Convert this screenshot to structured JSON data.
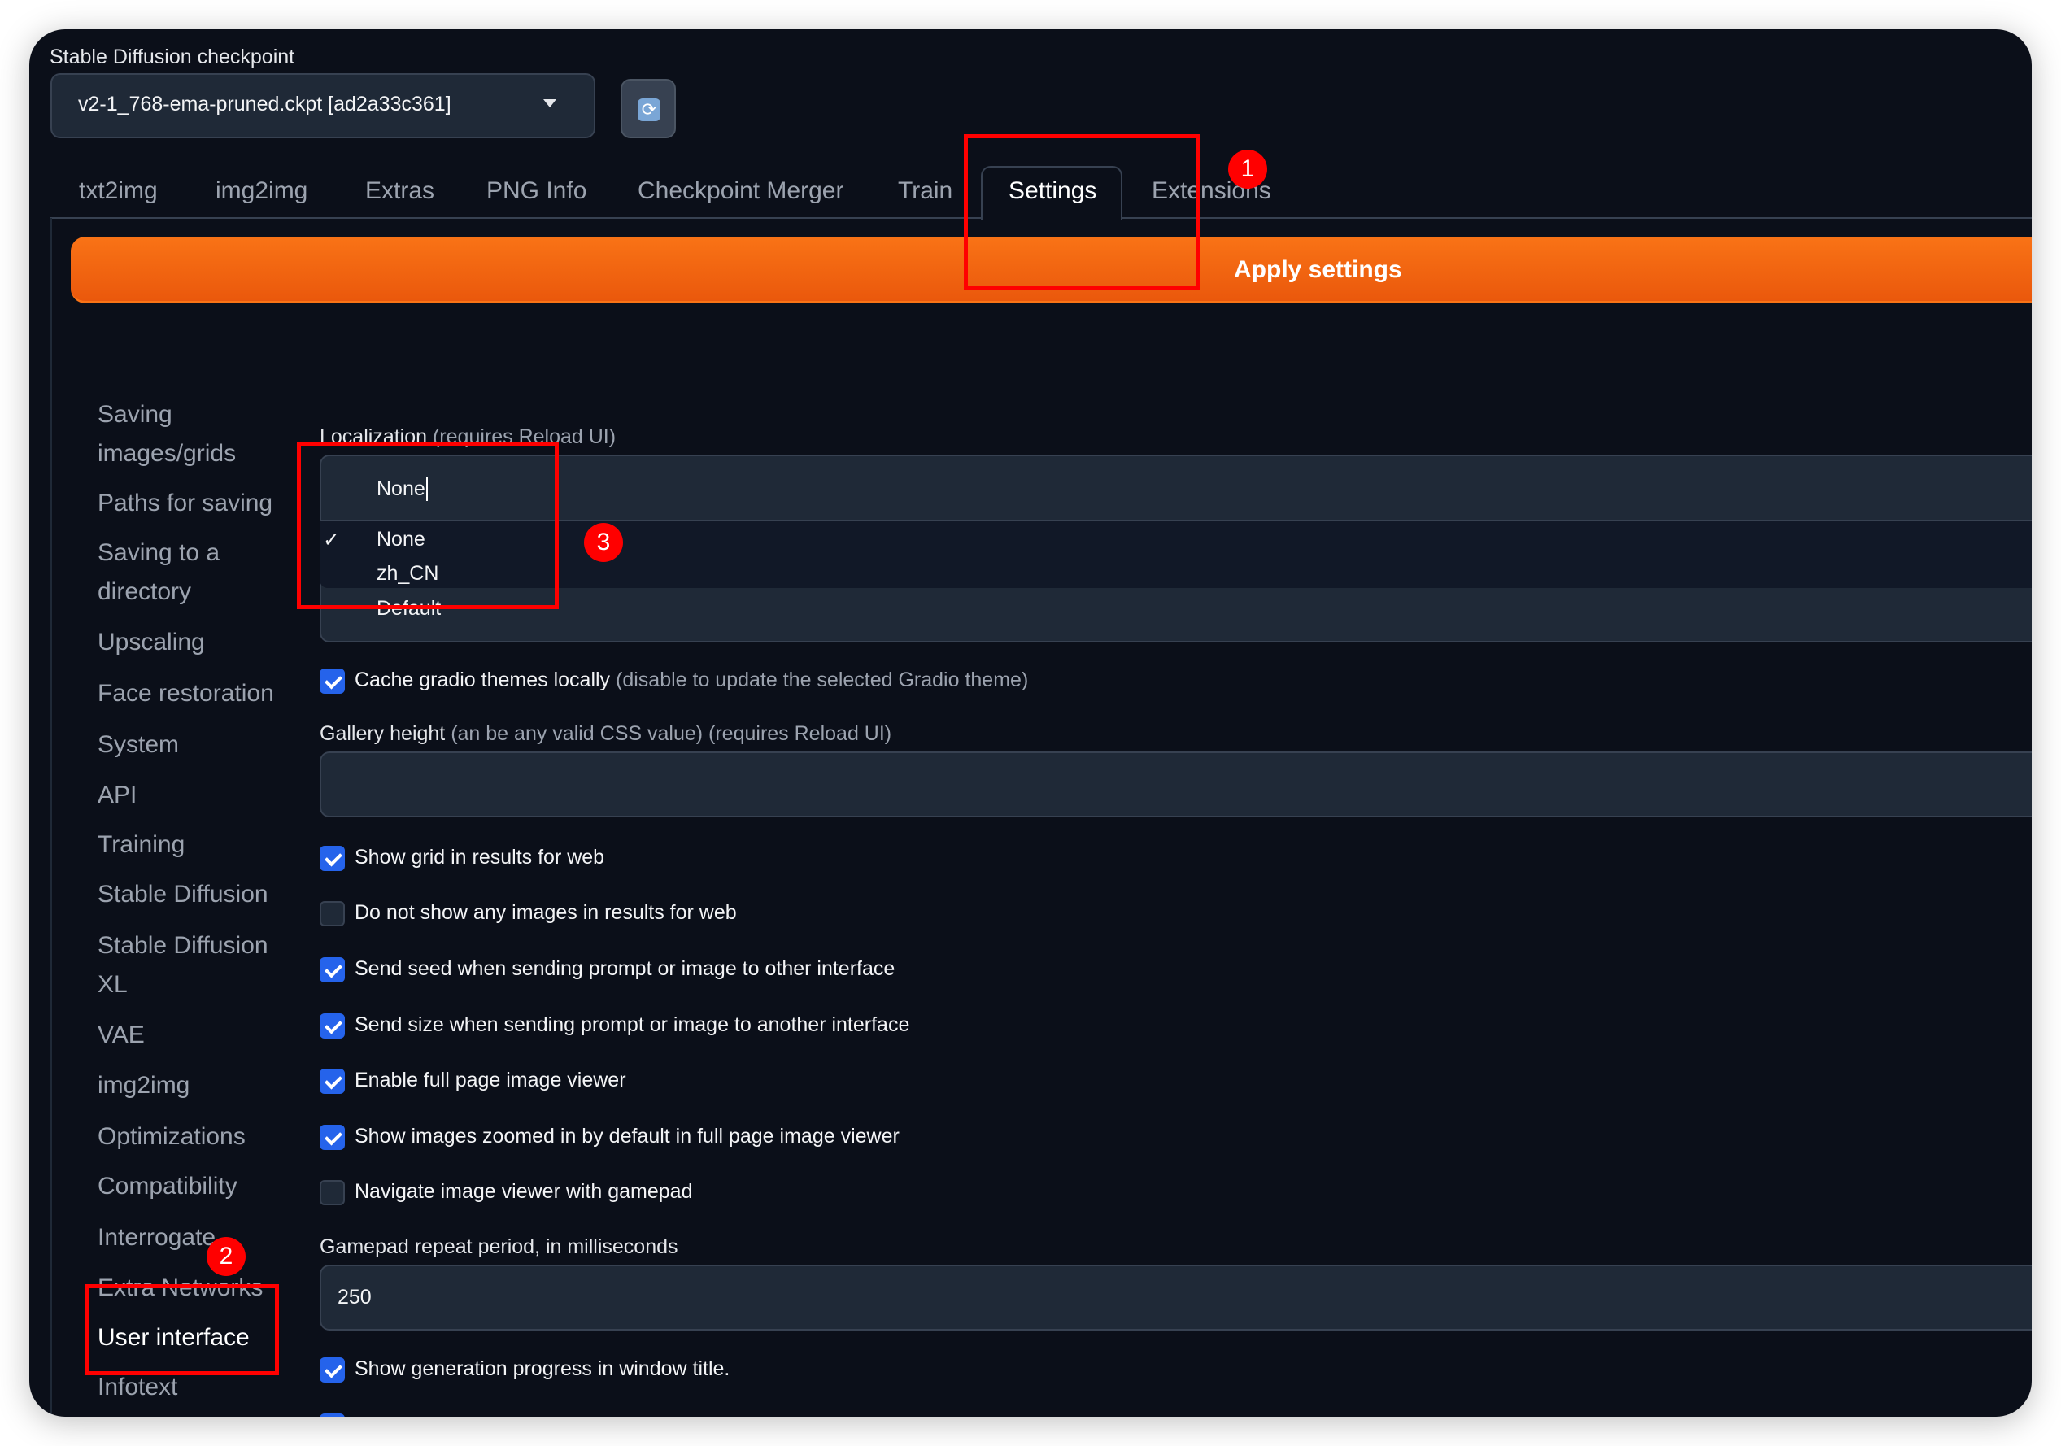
{
  "checkpoint": {
    "label": "Stable Diffusion checkpoint",
    "value": "v2-1_768-ema-pruned.ckpt [ad2a33c361]",
    "refresh_icon": "refresh-icon"
  },
  "tabs": [
    "txt2img",
    "img2img",
    "Extras",
    "PNG Info",
    "Checkpoint Merger",
    "Train",
    "Settings",
    "Extensions"
  ],
  "active_tab": "Settings",
  "apply_label": "Apply settings",
  "sidebar": [
    "Saving images/grids",
    "Paths for saving",
    "Saving to a directory",
    "Upscaling",
    "Face restoration",
    "System",
    "API",
    "Training",
    "Stable Diffusion",
    "Stable Diffusion XL",
    "VAE",
    "img2img",
    "Optimizations",
    "Compatibility",
    "Interrogate",
    "Extra Networks",
    "User interface",
    "Infotext"
  ],
  "sidebar_selected": "User interface",
  "settings": {
    "localization": {
      "label": "Localization",
      "note": "(requires Reload UI)",
      "value": "None",
      "options": [
        "None",
        "zh_CN"
      ],
      "selected": "None",
      "check": "✓"
    },
    "theme_value": "Default",
    "cache_themes": {
      "label": "Cache gradio themes locally",
      "note": "(disable to update the selected Gradio theme)",
      "checked": true
    },
    "gallery_height": {
      "label": "Gallery height",
      "note": "(an be any valid CSS value) (requires Reload UI)",
      "value": ""
    },
    "checkboxes": [
      {
        "label": "Show grid in results for web",
        "checked": true
      },
      {
        "label": "Do not show any images in results for web",
        "checked": false
      },
      {
        "label": "Send seed when sending prompt or image to other interface",
        "checked": true
      },
      {
        "label": "Send size when sending prompt or image to another interface",
        "checked": true
      },
      {
        "label": "Enable full page image viewer",
        "checked": true
      },
      {
        "label": "Show images zoomed in by default in full page image viewer",
        "checked": true
      },
      {
        "label": "Navigate image viewer with gamepad",
        "checked": false
      }
    ],
    "gamepad": {
      "label": "Gamepad repeat period, in milliseconds",
      "value": "250"
    },
    "show_progress": {
      "label": "Show generation progress in window title.",
      "checked": true
    }
  },
  "annotations": [
    "1",
    "2",
    "3"
  ],
  "colors": {
    "accent": "#f97316",
    "checkbox": "#2563eb",
    "annotation": "#ff0000",
    "background": "#0b0f19"
  }
}
